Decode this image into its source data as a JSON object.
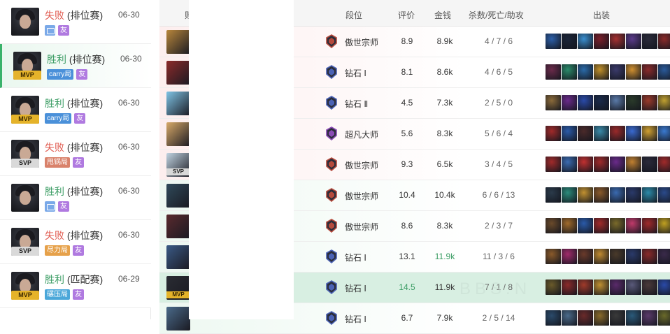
{
  "matches": [
    {
      "result": "失败",
      "outcome": "lose",
      "type": "(排位赛)",
      "date": "06-30",
      "badge": "",
      "tags": [
        {
          "kind": "img",
          "label": ""
        },
        {
          "kind": "friend",
          "label": "友"
        }
      ]
    },
    {
      "result": "胜利",
      "outcome": "win",
      "type": "(排位赛)",
      "date": "06-30",
      "badge": "MVP",
      "tags": [
        {
          "kind": "carry",
          "label": "carry局"
        },
        {
          "kind": "friend",
          "label": "友"
        }
      ]
    },
    {
      "result": "胜利",
      "outcome": "win",
      "type": "(排位赛)",
      "date": "06-30",
      "badge": "MVP",
      "tags": [
        {
          "kind": "carry",
          "label": "carry局"
        },
        {
          "kind": "friend",
          "label": "友"
        }
      ]
    },
    {
      "result": "失败",
      "outcome": "lose",
      "type": "(排位赛)",
      "date": "06-30",
      "badge": "SVP",
      "tags": [
        {
          "kind": "blame",
          "label": "甩锅局"
        },
        {
          "kind": "friend",
          "label": "友"
        }
      ]
    },
    {
      "result": "胜利",
      "outcome": "win",
      "type": "(排位赛)",
      "date": "06-30",
      "badge": "",
      "tags": [
        {
          "kind": "img",
          "label": ""
        },
        {
          "kind": "friend",
          "label": "友"
        }
      ]
    },
    {
      "result": "失败",
      "outcome": "lose",
      "type": "(排位赛)",
      "date": "06-30",
      "badge": "SVP",
      "tags": [
        {
          "kind": "effort",
          "label": "尽力局"
        },
        {
          "kind": "friend",
          "label": "友"
        }
      ]
    },
    {
      "result": "胜利",
      "outcome": "win",
      "type": "(匹配赛)",
      "date": "06-29",
      "badge": "MVP",
      "tags": [
        {
          "kind": "crush",
          "label": "碾压局"
        },
        {
          "kind": "friend",
          "label": "友"
        }
      ]
    }
  ],
  "table": {
    "headers": {
      "side": "败方",
      "rank": "段位",
      "score": "评价",
      "gold": "金钱",
      "kda": "杀数/死亡/助攻",
      "items": "出装"
    },
    "rows": [
      {
        "side": "lose",
        "overlay": "",
        "rank_tier": "grandmaster",
        "rank": "傲世宗师",
        "score": "8.9",
        "gold": "8.9k",
        "gold_green": false,
        "kda": "4 / 7 / 6",
        "kda_green": false,
        "champ_color": "#b8863b"
      },
      {
        "side": "lose",
        "overlay": "",
        "rank_tier": "diamond",
        "rank": "钻石 Ⅰ",
        "score": "8.1",
        "gold": "8.6k",
        "gold_green": false,
        "kda": "4 / 6 / 5",
        "kda_green": false,
        "champ_color": "#8c2a2a"
      },
      {
        "side": "lose",
        "overlay": "",
        "rank_tier": "diamond",
        "rank": "钻石 Ⅱ",
        "score": "4.5",
        "gold": "7.3k",
        "gold_green": false,
        "kda": "2 / 5 / 0",
        "kda_green": false,
        "champ_color": "#7fc4e6"
      },
      {
        "side": "lose",
        "overlay": "",
        "rank_tier": "master",
        "rank": "超凡大师",
        "score": "5.6",
        "gold": "8.3k",
        "gold_green": false,
        "kda": "5 / 6 / 4",
        "kda_green": false,
        "champ_color": "#d8a968"
      },
      {
        "side": "lose",
        "overlay": "SVP",
        "rank_tier": "grandmaster",
        "rank": "傲世宗师",
        "score": "9.3",
        "gold": "6.5k",
        "gold_green": false,
        "kda": "3 / 4 / 5",
        "kda_green": false,
        "champ_color": "#c2d4e2"
      },
      {
        "side": "win",
        "overlay": "",
        "rank_tier": "grandmaster",
        "rank": "傲世宗师",
        "score": "10.4",
        "gold": "10.4k",
        "gold_green": false,
        "kda": "6 / 6 / 13",
        "kda_green": false,
        "champ_color": "#2f4a5a"
      },
      {
        "side": "win",
        "overlay": "",
        "rank_tier": "grandmaster",
        "rank": "傲世宗师",
        "score": "8.6",
        "gold": "8.3k",
        "gold_green": false,
        "kda": "2 / 3 / 7",
        "kda_green": false,
        "champ_color": "#5a2a2e"
      },
      {
        "side": "win",
        "overlay": "",
        "rank_tier": "diamond",
        "rank": "钻石 Ⅰ",
        "score": "13.1",
        "gold": "11.9k",
        "gold_green": true,
        "kda": "11 / 3 / 6",
        "kda_green": true,
        "champ_color": "#3a5a86"
      },
      {
        "side": "hl",
        "overlay": "MVP",
        "rank_tier": "diamond",
        "rank": "钻石 Ⅰ",
        "score": "14.5",
        "gold": "11.9k",
        "gold_green": false,
        "kda": "7 / 1 / 8",
        "kda_green": false,
        "champ_color": "#2a2c33"
      },
      {
        "side": "win",
        "overlay": "",
        "rank_tier": "diamond",
        "rank": "钻石 Ⅰ",
        "score": "6.7",
        "gold": "7.9k",
        "gold_green": false,
        "kda": "2 / 5 / 14",
        "kda_green": false,
        "champ_color": "#4a6a8a"
      }
    ]
  },
  "watermark": "BBS.N",
  "colors": {
    "win": "#3a9c63",
    "lose": "#e05a4f",
    "highlight": "#d8efe2"
  }
}
